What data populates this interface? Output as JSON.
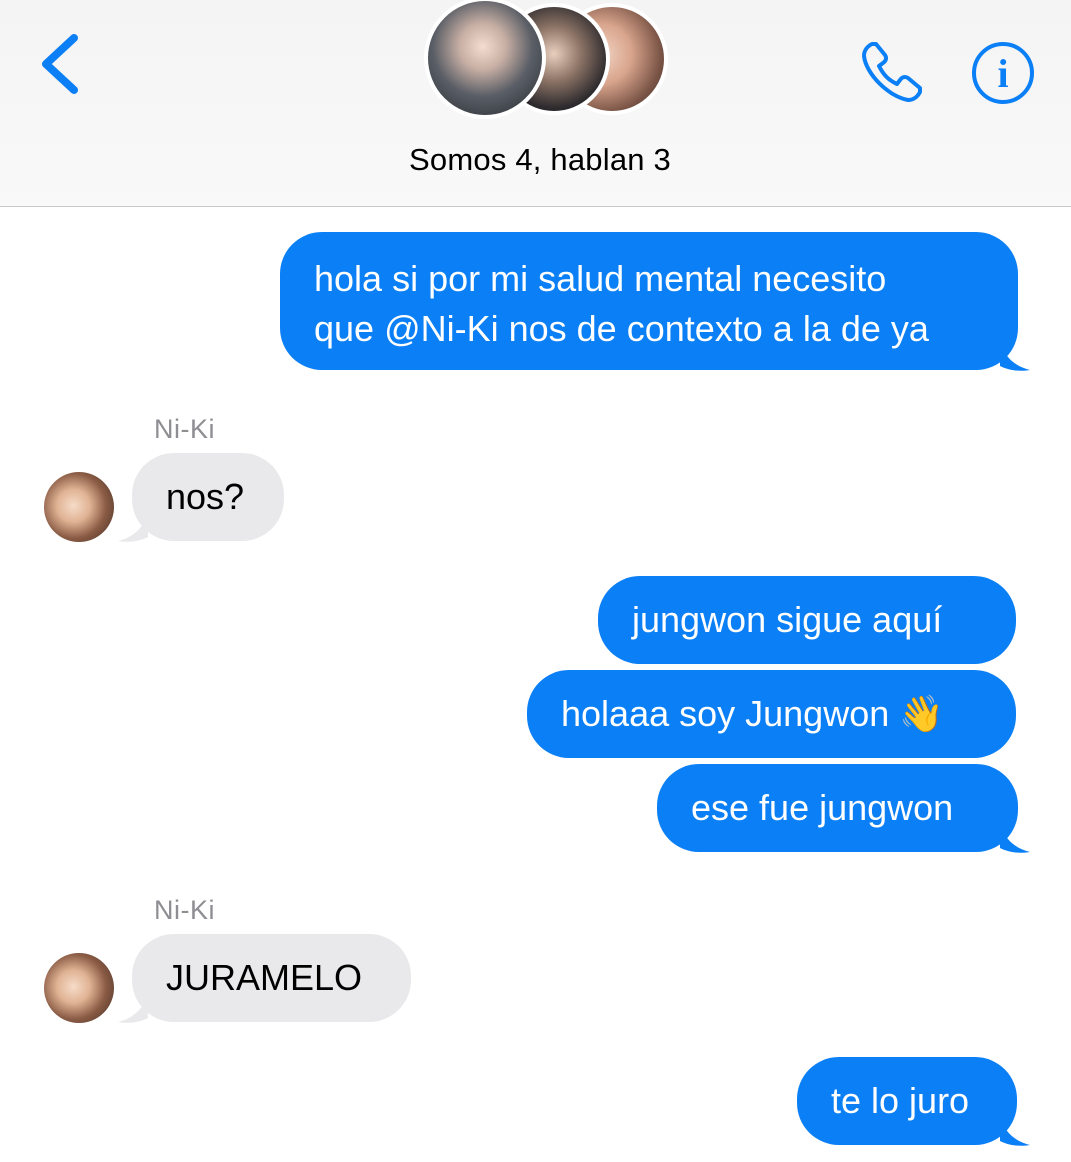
{
  "header": {
    "title": "Somos 4, hablan 3",
    "accent_color": "#0b7ff5",
    "icons": [
      "chevron-left-icon",
      "phone-icon",
      "info-icon"
    ]
  },
  "messages": [
    {
      "direction": "outgoing",
      "lines": [
        "hola si por mi salud mental necesito",
        "que @Ni-Ki nos de contexto a la de ya"
      ]
    },
    {
      "direction": "incoming",
      "sender": "Ni-Ki",
      "text": "nos?"
    },
    {
      "direction": "outgoing",
      "text": "jungwon sigue aquí"
    },
    {
      "direction": "outgoing",
      "text": "holaaa soy Jungwon 👋"
    },
    {
      "direction": "outgoing",
      "text": "ese fue jungwon"
    },
    {
      "direction": "incoming",
      "sender": "Ni-Ki",
      "text": "JURAMELO"
    },
    {
      "direction": "outgoing",
      "text": "te lo juro"
    }
  ],
  "colors": {
    "outgoing_bubble": "#0b7ff5",
    "incoming_bubble": "#e9e9eb",
    "sender_label": "#8e8e93"
  }
}
